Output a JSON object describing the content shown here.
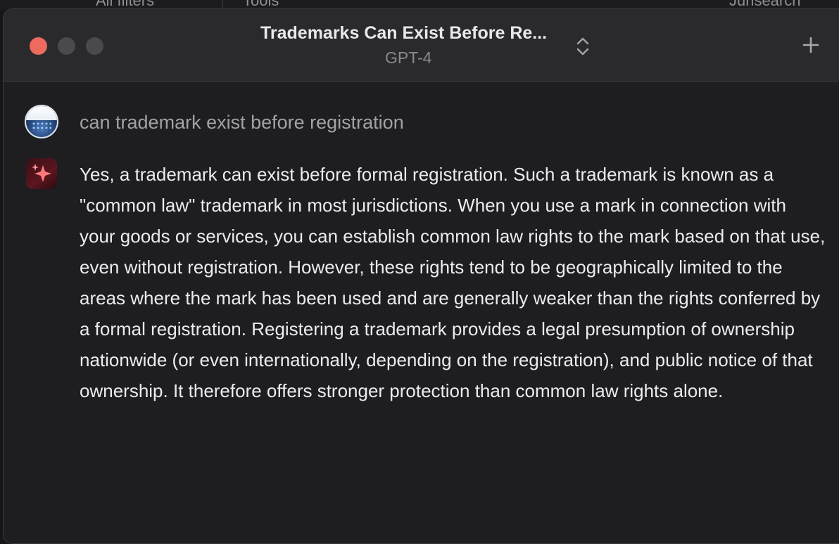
{
  "background_window": {
    "tabs": [
      "All filters",
      "Tools",
      "Jurisearch"
    ]
  },
  "window": {
    "title": "Trademarks Can Exist Before Re...",
    "model": "GPT-4",
    "controls": {
      "close_color": "#ed6a5e",
      "minimize_color": "#4a4a4d",
      "maximize_color": "#4a4a4d"
    },
    "icons": {
      "model_switch": "chevron-up-down-icon",
      "new_chat": "plus-icon"
    }
  },
  "conversation": {
    "user": {
      "avatar": "user-avatar",
      "message": "can trademark exist before registration"
    },
    "assistant": {
      "avatar": "sparkle-avatar",
      "message": "Yes, a trademark can exist before formal registration. Such a trademark is known as a \"common law\" trademark in most jurisdictions. When you use a mark in connection with your goods or services, you can establish common law rights to the mark based on that use, even without registration. However, these rights tend to be geographically limited to the areas where the mark has been used and are generally weaker than the rights conferred by a formal registration. Registering a trademark provides a legal presumption of ownership nationwide (or even internationally, depending on the registration), and public notice of that ownership. It therefore offers stronger protection than common law rights alone."
    }
  }
}
